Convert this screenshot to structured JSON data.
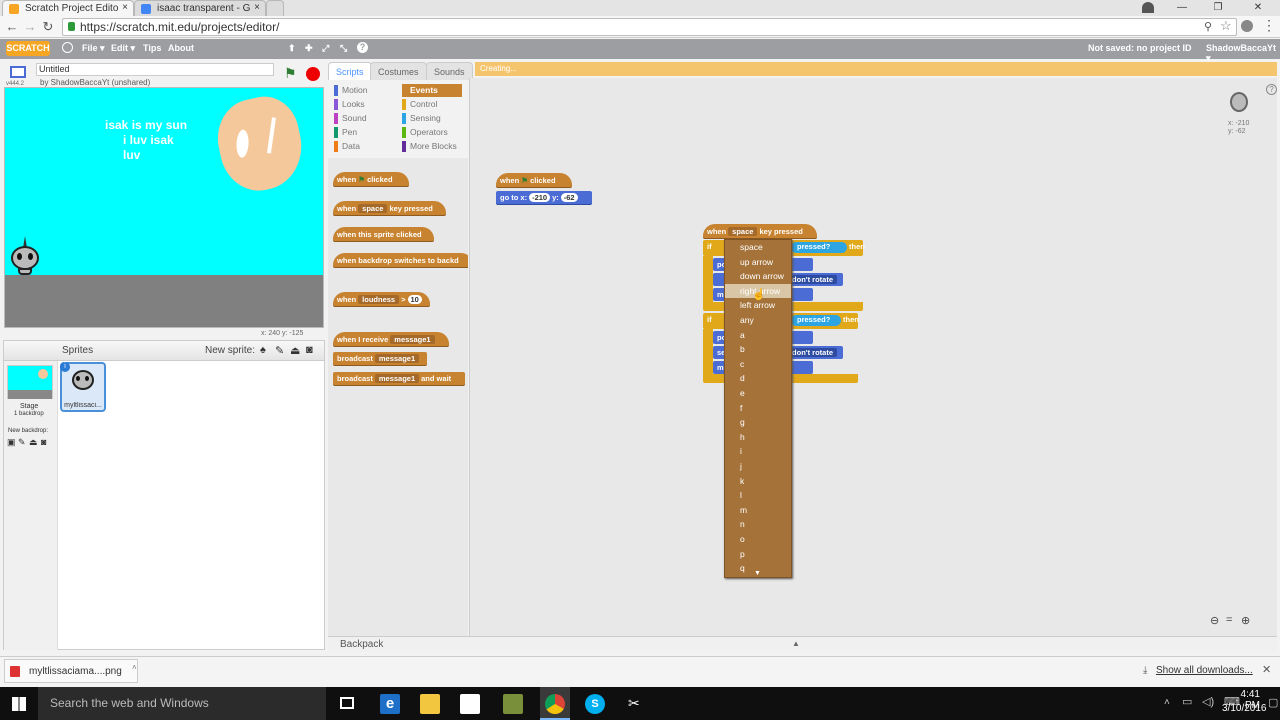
{
  "browser": {
    "tabs": [
      {
        "label": "Scratch Project Edito",
        "close": "×"
      },
      {
        "label": "isaac transparent - G",
        "close": "×"
      }
    ],
    "url": "https://scratch.mit.edu/projects/editor/",
    "window_controls": [
      "—",
      "❐",
      "✕"
    ]
  },
  "scratch_menu": {
    "logo": "SCRATCH",
    "items": [
      "File ▾",
      "Edit ▾",
      "Tips",
      "About"
    ],
    "status": "Not saved: no project ID",
    "user": "ShadowBaccaYt ▾"
  },
  "project": {
    "title_value": "Untitled",
    "byline": "by ShadowBaccaYt (unshared)",
    "version": "v444.2",
    "stage_coords": "x: 240  y: -125"
  },
  "stage_text": [
    "isak is my sun",
    "i luv isak",
    "luv"
  ],
  "sprites_panel": {
    "title": "Sprites",
    "new_sprite_label": "New sprite:",
    "stage_label": "Stage",
    "stage_sub": "1 backdrop",
    "new_backdrop": "New backdrop:",
    "sprite_name": "myltlissaci..."
  },
  "palette": {
    "tabs": [
      "Scripts",
      "Costumes",
      "Sounds"
    ],
    "categories_left": [
      "Motion",
      "Looks",
      "Sound",
      "Pen",
      "Data"
    ],
    "categories_right": [
      "Events",
      "Control",
      "Sensing",
      "Operators",
      "More Blocks"
    ],
    "blocks": {
      "when_flag": [
        "when",
        "clicked"
      ],
      "when_key": [
        "when",
        "space",
        "key pressed"
      ],
      "when_sprite": "when this sprite clicked",
      "when_backdrop": "when backdrop switches to  backd",
      "when_loud": [
        "when",
        "loudness",
        ">",
        "10"
      ],
      "when_receive": [
        "when I receive",
        "message1"
      ],
      "broadcast": [
        "broadcast",
        "message1"
      ],
      "broadcast_wait": [
        "broadcast",
        "message1",
        "and wait"
      ]
    }
  },
  "scripts_area": {
    "status": "Creating...",
    "sprite_coords": "x: -210\ny: -62",
    "script1": {
      "hat": [
        "when",
        "clicked"
      ],
      "goto": [
        "go to x:",
        "-210",
        "y:",
        "-62"
      ]
    },
    "script2": {
      "hat": [
        "when",
        "space",
        "key pressed"
      ],
      "pressed1": "pressed?",
      "then": "then",
      "pressed2": "pressed?",
      "dont_rotate": "don't rotate",
      "if": "if",
      "po": "po",
      "se": "se",
      "m": "m"
    },
    "key_dropdown": [
      "space",
      "up arrow",
      "down arrow",
      "right arrow",
      "left arrow",
      "any",
      "a",
      "b",
      "c",
      "d",
      "e",
      "f",
      "g",
      "h",
      "i",
      "j",
      "k",
      "l",
      "m",
      "n",
      "o",
      "p",
      "q"
    ],
    "highlighted_key": "right arrow"
  },
  "backpack": "Backpack",
  "downloads": {
    "file": "myltlissaciama....png",
    "show_all": "Show all downloads..."
  },
  "taskbar": {
    "search_placeholder": "Search the web and Windows",
    "time": "4:41 PM",
    "date": "3/10/2016"
  },
  "colors": {
    "events": "#c88330",
    "motion": "#4a6cd4",
    "control": "#e1a91a",
    "sensing": "#2ca5e2",
    "stage_bg": "#00ffff",
    "ground": "#808080"
  }
}
